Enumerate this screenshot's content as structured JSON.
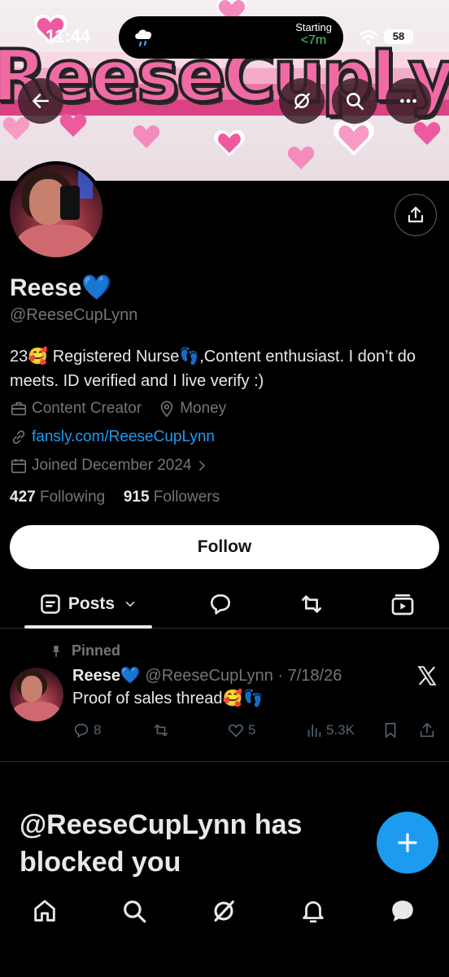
{
  "status_bar": {
    "time": "11:44",
    "activity_label": "Starting",
    "activity_value": "<7m",
    "battery": "58"
  },
  "banner": {
    "text": "ReeseCupLynn",
    "colors": {
      "pink": "#f06aa5",
      "light_pink": "#f8d7e4",
      "deep_pink": "#d93a7f"
    }
  },
  "top_buttons": {
    "back_icon": "arrow-left-icon",
    "grok_icon": "grok-slash-icon",
    "search_icon": "search-icon",
    "more_icon": "ellipsis-icon"
  },
  "profile": {
    "name": "Reese",
    "name_emoji": "💙",
    "handle": "@ReeseCupLynn",
    "bio": "23🥰 Registered Nurse👣,Content enthusiast. I don’t do meets. ID verified and I live verify :)",
    "category": "Content Creator",
    "location": "Money",
    "website": "fansly.com/ReeseCupLynn",
    "joined": "Joined December 2024",
    "following_count": "427",
    "following_label": "Following",
    "followers_count": "915",
    "followers_label": "Followers"
  },
  "follow_button": {
    "label": "Follow"
  },
  "tabs": {
    "active_label": "Posts",
    "icons": [
      "posts-icon",
      "replies-icon",
      "reposts-icon",
      "media-icon"
    ]
  },
  "pinned_post": {
    "pinned_label": "Pinned",
    "name": "Reese💙",
    "handle_date": "@ReeseCupLynn · 7/18/26",
    "text": "Proof of sales thread🥰👣",
    "replies": "8",
    "likes": "5",
    "views": "5.3K"
  },
  "blocked_message": "@ReeseCupLynn has blocked you",
  "colors": {
    "accent": "#1d9bf0",
    "background": "#000000",
    "muted": "#71767b"
  },
  "bottom_nav": [
    "home-icon",
    "search-icon",
    "grok-icon",
    "notifications-icon",
    "messages-icon"
  ]
}
